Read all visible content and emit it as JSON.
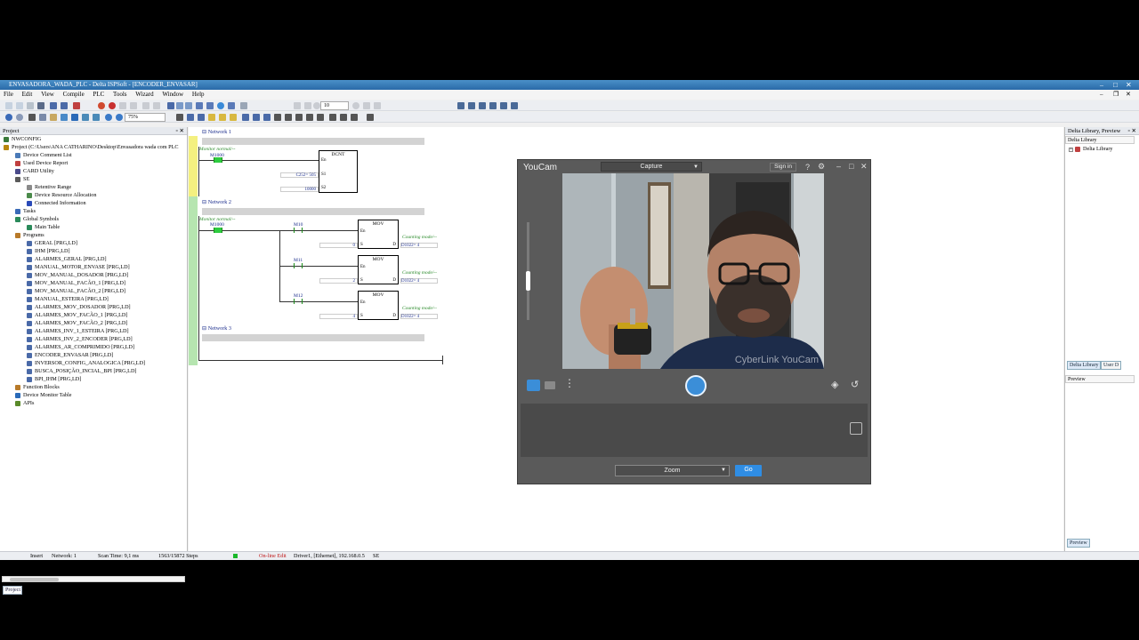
{
  "window": {
    "title": "ENVASADORA_WADA_PLC - Delta ISPSoft - [ENCODER_ENVASAR]"
  },
  "menu": [
    "File",
    "Edit",
    "View",
    "Compile",
    "PLC",
    "Tools",
    "Wizard",
    "Window",
    "Help"
  ],
  "toolbar": {
    "zoom": "75%",
    "scan_box": "10"
  },
  "project_panel": {
    "title": "Project",
    "tab": "Project",
    "tree": [
      {
        "label": "NWCONFIG",
        "level": 0,
        "icon": "network-config-icon",
        "color": "#3a7a3a"
      },
      {
        "label": "Project (C:\\Users\\ANA CATHARINO\\Desktop\\Envasadora wada com PLC",
        "level": 0,
        "icon": "project-icon",
        "color": "#b8860b"
      },
      {
        "label": "Device Comment List",
        "level": 1,
        "icon": "comment-list-icon",
        "color": "#4a7ab8"
      },
      {
        "label": "Used Device Report",
        "level": 1,
        "icon": "report-icon",
        "color": "#c04040"
      },
      {
        "label": "CARD Utility",
        "level": 1,
        "icon": "card-icon",
        "color": "#4a4a8a"
      },
      {
        "label": "SE",
        "level": 1,
        "icon": "se-device-icon",
        "color": "#5a5a5a"
      },
      {
        "label": "Retentive Range",
        "level": 2,
        "icon": "retentive-icon",
        "color": "#8a8a8a"
      },
      {
        "label": "Device Resource Allocation",
        "level": 2,
        "icon": "resource-icon",
        "color": "#4a8a4a"
      },
      {
        "label": "Connected Information",
        "level": 2,
        "icon": "info-icon",
        "color": "#2a4ab8"
      },
      {
        "label": "Tasks",
        "level": 1,
        "icon": "tasks-icon",
        "color": "#3a6ab8"
      },
      {
        "label": "Global Symbols",
        "level": 1,
        "icon": "globe-icon",
        "color": "#2a8a5a"
      },
      {
        "label": "Main Table",
        "level": 2,
        "icon": "table-icon",
        "color": "#2a8a5a"
      },
      {
        "label": "Programs",
        "level": 1,
        "icon": "folder-icon",
        "color": "#b87a2a"
      },
      {
        "label": "GERAL [PRG,LD]",
        "level": 2,
        "icon": "ladder-program-icon",
        "color": "#4a6aa8"
      },
      {
        "label": "IHM [PRG,LD]",
        "level": 2,
        "icon": "ladder-program-icon",
        "color": "#4a6aa8"
      },
      {
        "label": "ALARMES_GERAL [PRG,LD]",
        "level": 2,
        "icon": "ladder-program-icon",
        "color": "#4a6aa8"
      },
      {
        "label": "MANUAL_MOTOR_ENVASE [PRG,LD]",
        "level": 2,
        "icon": "ladder-program-icon",
        "color": "#4a6aa8"
      },
      {
        "label": "MOV_MANUAL_DOSADOR [PRG,LD]",
        "level": 2,
        "icon": "ladder-program-icon",
        "color": "#4a6aa8"
      },
      {
        "label": "MOV_MANUAL_FACÃO_1 [PRG,LD]",
        "level": 2,
        "icon": "ladder-program-icon",
        "color": "#4a6aa8"
      },
      {
        "label": "MOV_MANUAL_FACÃO_2 [PRG,LD]",
        "level": 2,
        "icon": "ladder-program-icon",
        "color": "#4a6aa8"
      },
      {
        "label": "MANUAL_ESTEIRA [PRG,LD]",
        "level": 2,
        "icon": "ladder-program-icon",
        "color": "#4a6aa8"
      },
      {
        "label": "ALARMES_MOV_DOSADOR [PRG,LD]",
        "level": 2,
        "icon": "ladder-program-icon",
        "color": "#4a6aa8"
      },
      {
        "label": "ALARMES_MOV_FACÃO_1 [PRG,LD]",
        "level": 2,
        "icon": "ladder-program-icon",
        "color": "#4a6aa8"
      },
      {
        "label": "ALARMES_MOV_FACÃO_2 [PRG,LD]",
        "level": 2,
        "icon": "ladder-program-icon",
        "color": "#4a6aa8"
      },
      {
        "label": "ALARMES_INV_1_ESTEIRA [PRG,LD]",
        "level": 2,
        "icon": "ladder-program-icon",
        "color": "#4a6aa8"
      },
      {
        "label": "ALARMES_INV_2_ENCODER [PRG,LD]",
        "level": 2,
        "icon": "ladder-program-icon",
        "color": "#4a6aa8"
      },
      {
        "label": "ALARMES_AR_COMPRIMIDO [PRG,LD]",
        "level": 2,
        "icon": "ladder-program-icon",
        "color": "#4a6aa8"
      },
      {
        "label": "ENCODER_ENVASAR [PRG,LD]",
        "level": 2,
        "icon": "ladder-program-icon",
        "color": "#4a6aa8"
      },
      {
        "label": "INVERSOR_CONFIG_ANALOGICA [PRG,LD]",
        "level": 2,
        "icon": "ladder-program-icon",
        "color": "#4a6aa8"
      },
      {
        "label": "BUSCA_POSIÇÃO_INCIAL_BPI [PRG,LD]",
        "level": 2,
        "icon": "ladder-program-icon",
        "color": "#4a6aa8"
      },
      {
        "label": "BPI_IHM [PRG,LD]",
        "level": 2,
        "icon": "ladder-program-icon",
        "color": "#4a6aa8"
      },
      {
        "label": "Function Blocks",
        "level": 1,
        "icon": "function-blocks-icon",
        "color": "#b87a2a"
      },
      {
        "label": "Device Monitor Table",
        "level": 1,
        "icon": "monitor-table-icon",
        "color": "#2a6ab8"
      },
      {
        "label": "APIs",
        "level": 1,
        "icon": "api-icon",
        "color": "#5a8a2a"
      }
    ]
  },
  "ladder": {
    "networks": [
      "Network 1",
      "Network 2",
      "Network 3"
    ],
    "n1": {
      "comment": "Monitor normal/--",
      "contact": "M1000",
      "block": "DCNT",
      "pins": [
        "En",
        "S1",
        "S2"
      ],
      "s1_value": "C252= 505",
      "s2_value": "10000"
    },
    "n2": {
      "comment": "Monitor normal/--",
      "contact": "M1000",
      "rungs": [
        {
          "contact": "M10",
          "block": "MOV",
          "in_value": "0",
          "out_label": "Counting mode/--",
          "out_value": "D1022= 4"
        },
        {
          "contact": "M11",
          "block": "MOV",
          "in_value": "2",
          "out_label": "Counting mode/--",
          "out_value": "D1022= 4"
        },
        {
          "contact": "M12",
          "block": "MOV",
          "in_value": "4",
          "out_label": "Counting mode/--",
          "out_value": "D1022= 4"
        }
      ],
      "pins": [
        "En",
        "S",
        "D"
      ]
    }
  },
  "library": {
    "title": "Delta Library, Preview",
    "sub": "Delta Library",
    "item": "Delta Library",
    "tabs": [
      "Delta Library",
      "User D"
    ],
    "preview_title": "Preview",
    "preview_tab": "Preview"
  },
  "status": {
    "mode": "Insert",
    "network": "Network: 1",
    "scan": "Scan Time: 9,1 ms",
    "steps": "1563/15872 Steps",
    "edit": "On-line Edit",
    "driver": "Driver1, [Ethernet], 192.168.0.5",
    "plc": "SE"
  },
  "youcam": {
    "title": "YouCam",
    "mode": "Capture",
    "sign_in": "Sign in",
    "watermark": "CyberLink YouCam",
    "zoom": "Zoom",
    "go": "Go"
  }
}
